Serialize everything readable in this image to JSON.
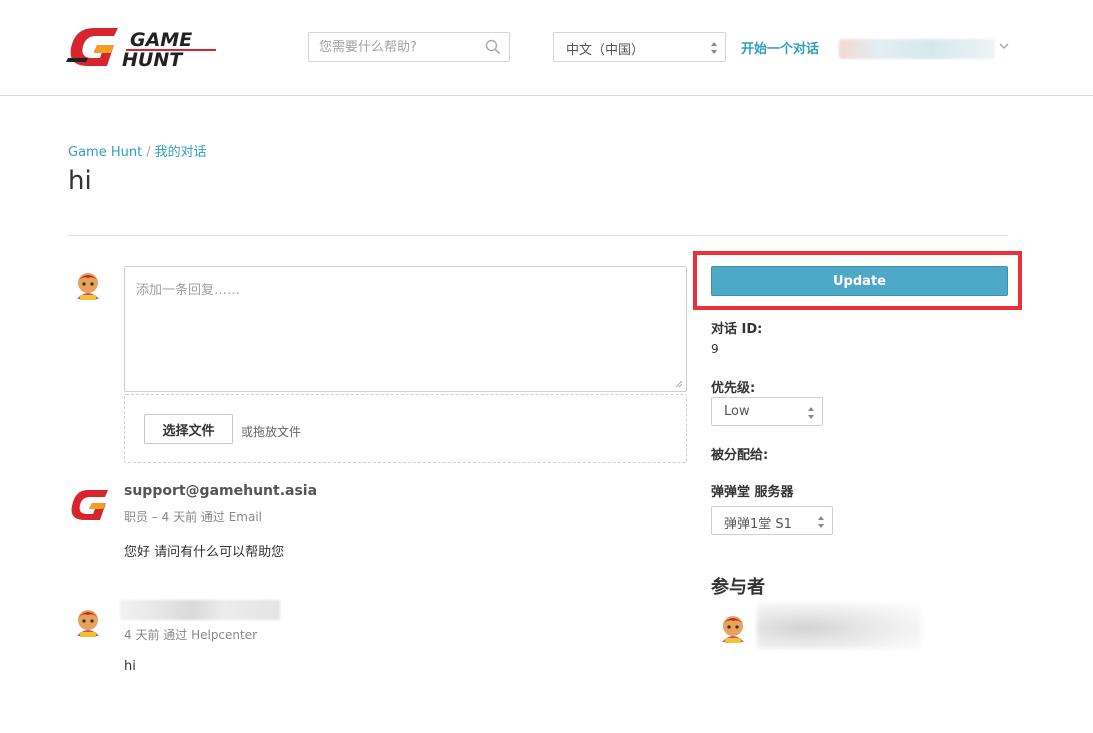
{
  "header": {
    "logo_text_1": "GAME",
    "logo_text_2": "HUNT",
    "search_placeholder": "您需要什么帮助?",
    "language_selected": "中文（中国）",
    "start_conversation": "开始一个对话"
  },
  "breadcrumb": {
    "home": "Game Hunt",
    "separator": "/",
    "current": "我的对话"
  },
  "ticket": {
    "title": "hi"
  },
  "reply": {
    "placeholder": "添加一条回复……",
    "choose_file_label": "选择文件",
    "drop_hint": "或拖放文件"
  },
  "comments": [
    {
      "author": "support@gamehunt.asia",
      "meta": "职员 – 4 天前 通过 Email",
      "body": "您好 请问有什么可以帮助您"
    },
    {
      "author": "",
      "meta": "4 天前 通过 Helpcenter",
      "body": "hi"
    }
  ],
  "sidebar": {
    "update_label": "Update",
    "ticket_id_label": "对话 ID:",
    "ticket_id_value": "9",
    "priority_label": "优先级:",
    "priority_value": "Low",
    "assignee_label": "被分配给:",
    "server_label": "弹弹堂 服务器",
    "server_value": "弹弹1堂 S1",
    "participants_title": "参与者"
  },
  "colors": {
    "accent": "#2f9fbd",
    "update_button": "#4ea8c8",
    "highlight": "#e8313b",
    "logo_red": "#d8242c"
  },
  "icons": [
    "search-icon",
    "chevron-down-icon",
    "select-arrows-icon",
    "resize-handle-icon",
    "avatar-icon",
    "logo-icon"
  ]
}
